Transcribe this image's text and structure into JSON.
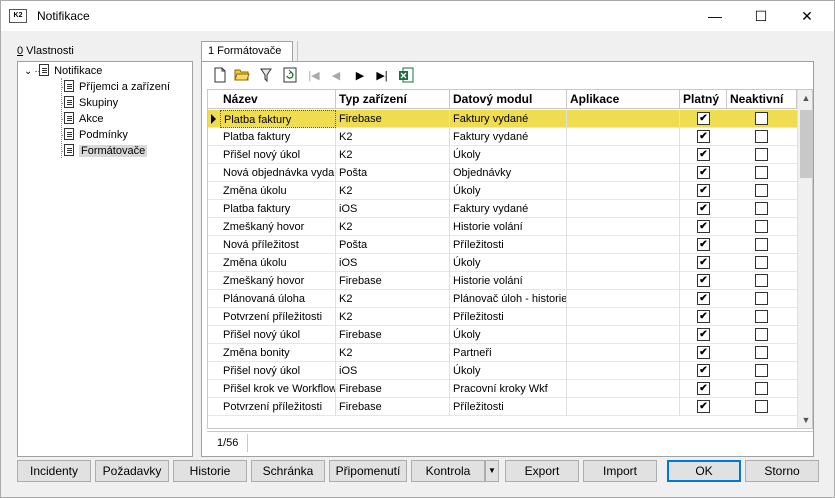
{
  "window": {
    "app_icon_text": "K2",
    "title": "Notifikace",
    "minimize": "—",
    "maximize": "☐",
    "close": "✕"
  },
  "left": {
    "label_prefix": "0",
    "label_rest": " Vlastnosti",
    "tree": {
      "root": "Notifikace",
      "expander": "⌄",
      "children": [
        "Příjemci a zařízení",
        "Skupiny",
        "Akce",
        "Podmínky",
        "Formátovače"
      ]
    }
  },
  "tab": {
    "label": "1 Formátovače"
  },
  "toolbar": {
    "icons": [
      "new-icon",
      "open-icon",
      "filter-icon",
      "refresh-icon",
      "first-icon",
      "prev-icon",
      "next-icon",
      "last-icon",
      "excel-icon"
    ]
  },
  "grid": {
    "columns": [
      "Název",
      "Typ zařízení",
      "Datový modul",
      "Aplikace",
      "Platný",
      "Neaktivní"
    ],
    "rows": [
      {
        "nazev": "Platba faktury",
        "typ": "Firebase",
        "modul": "Faktury vydané",
        "aplikace": "",
        "platny": "✔",
        "neaktivni": ""
      },
      {
        "nazev": "Platba faktury",
        "typ": "K2",
        "modul": "Faktury vydané",
        "aplikace": "",
        "platny": "✔",
        "neaktivni": ""
      },
      {
        "nazev": "Přišel nový úkol",
        "typ": "K2",
        "modul": "Úkoly",
        "aplikace": "",
        "platny": "✔",
        "neaktivni": ""
      },
      {
        "nazev": "Nová objednávka vydaná",
        "typ": "Pošta",
        "modul": "Objednávky",
        "aplikace": "",
        "platny": "✔",
        "neaktivni": ""
      },
      {
        "nazev": "Změna úkolu",
        "typ": "K2",
        "modul": "Úkoly",
        "aplikace": "",
        "platny": "✔",
        "neaktivni": ""
      },
      {
        "nazev": "Platba faktury",
        "typ": "iOS",
        "modul": "Faktury vydané",
        "aplikace": "",
        "platny": "✔",
        "neaktivni": ""
      },
      {
        "nazev": "Zmeškaný hovor",
        "typ": "K2",
        "modul": "Historie volání",
        "aplikace": "",
        "platny": "✔",
        "neaktivni": ""
      },
      {
        "nazev": "Nová příležitost",
        "typ": "Pošta",
        "modul": "Příležitosti",
        "aplikace": "",
        "platny": "✔",
        "neaktivni": ""
      },
      {
        "nazev": "Změna úkolu",
        "typ": "iOS",
        "modul": "Úkoly",
        "aplikace": "",
        "platny": "✔",
        "neaktivni": ""
      },
      {
        "nazev": "Zmeškaný hovor",
        "typ": "Firebase",
        "modul": "Historie volání",
        "aplikace": "",
        "platny": "✔",
        "neaktivni": ""
      },
      {
        "nazev": "Plánovaná úloha",
        "typ": "K2",
        "modul": "Plánovač úloh - historie",
        "aplikace": "",
        "platny": "✔",
        "neaktivni": ""
      },
      {
        "nazev": "Potvrzení příležitosti",
        "typ": "K2",
        "modul": "Příležitosti",
        "aplikace": "",
        "platny": "✔",
        "neaktivni": ""
      },
      {
        "nazev": "Přišel nový úkol",
        "typ": "Firebase",
        "modul": "Úkoly",
        "aplikace": "",
        "platny": "✔",
        "neaktivni": ""
      },
      {
        "nazev": "Změna bonity",
        "typ": "K2",
        "modul": "Partneři",
        "aplikace": "",
        "platny": "✔",
        "neaktivni": ""
      },
      {
        "nazev": "Přišel nový úkol",
        "typ": "iOS",
        "modul": "Úkoly",
        "aplikace": "",
        "platny": "✔",
        "neaktivni": ""
      },
      {
        "nazev": "Přišel krok ve Workflow",
        "typ": "Firebase",
        "modul": "Pracovní kroky Wkf",
        "aplikace": "",
        "platny": "✔",
        "neaktivni": ""
      },
      {
        "nazev": "Potvrzení příležitosti",
        "typ": "Firebase",
        "modul": "Příležitosti",
        "aplikace": "",
        "platny": "✔",
        "neaktivni": ""
      }
    ],
    "selected_row": 0,
    "status": "1/56"
  },
  "buttons": {
    "incidenty": "Incidenty",
    "pozadavky": "Požadavky",
    "historie": "Historie",
    "schranka": "Schránka",
    "pripomenuti": "Připomenutí",
    "kontrola": "Kontrola",
    "kontrola_arrow": "▼",
    "export": "Export",
    "import": "Import",
    "ok": "OK",
    "storno": "Storno"
  },
  "colors": {
    "selected_row": "#f0dc50",
    "default_button_border": "#0078d7"
  }
}
